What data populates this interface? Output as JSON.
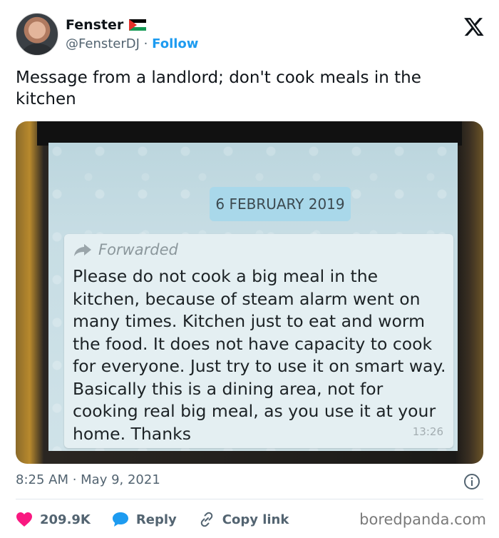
{
  "author": {
    "name": "Fenster",
    "handle": "@FensterDJ",
    "separator": "·",
    "follow_label": "Follow"
  },
  "icons": {
    "flag": "palestine-flag-icon",
    "x_logo": "x-logo-icon",
    "forward": "forward-arrow-icon",
    "info": "info-icon",
    "like": "heart-icon",
    "reply": "reply-bubble-icon",
    "copy": "link-icon"
  },
  "tweet": {
    "text": "Message from a landlord; don't cook meals in the kitchen"
  },
  "media": {
    "date_pill": "6 FEBRUARY 2019",
    "forwarded_label": "Forwarded",
    "message": "Please do not cook a  big meal in the kitchen, because of steam alarm went on many times. Kitchen just to eat and worm the food. It does not have capacity to cook for everyone. Just try to use it on smart way. Basically this is a dining area, not for cooking real big meal, as you use it at your home. Thanks",
    "message_time": "13:26"
  },
  "meta": {
    "timestamp": "8:25 AM · May 9, 2021"
  },
  "actions": {
    "likes": "209.9K",
    "reply_label": "Reply",
    "copy_label": "Copy link"
  },
  "watermark": "boredpanda.com",
  "colors": {
    "accent": "#1d9bf0",
    "like": "#f91880",
    "text": "#0f1419",
    "muted": "#536471"
  }
}
